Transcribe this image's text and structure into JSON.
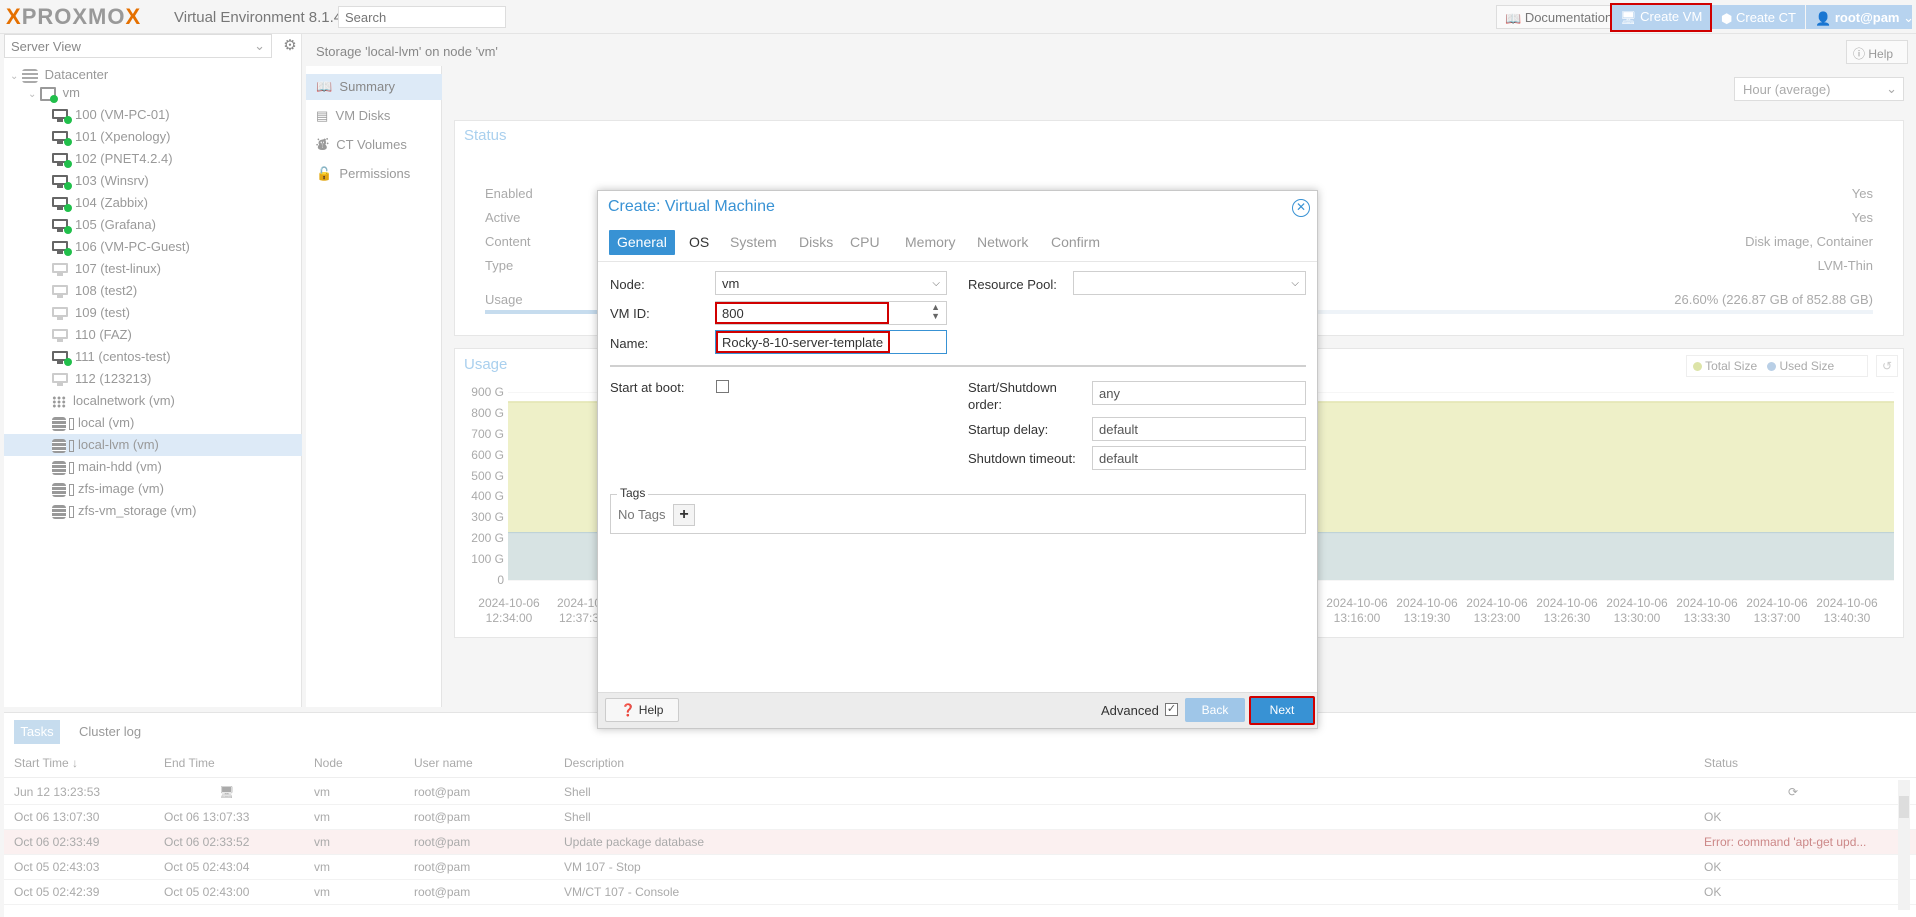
{
  "topbar": {
    "logo_left": "X",
    "logo_mid": "PROXMO",
    "logo_right": "X",
    "version": "Virtual Environment 8.1.4",
    "search_placeholder": "Search",
    "documentation": "Documentation",
    "create_vm": "Create VM",
    "create_ct": "Create CT",
    "user": "root@pam"
  },
  "tree": {
    "view_selector": "Server View",
    "datacenter": "Datacenter",
    "node": "vm",
    "vms": [
      {
        "label": "100 (VM-PC-01)",
        "running": true
      },
      {
        "label": "101 (Xpenology)",
        "running": true
      },
      {
        "label": "102 (PNET4.2.4)",
        "running": true
      },
      {
        "label": "103 (Winsrv)",
        "running": true
      },
      {
        "label": "104 (Zabbix)",
        "running": true
      },
      {
        "label": "105 (Grafana)",
        "running": true
      },
      {
        "label": "106 (VM-PC-Guest)",
        "running": true
      },
      {
        "label": "107 (test-linux)",
        "running": false
      },
      {
        "label": "108 (test2)",
        "running": false
      },
      {
        "label": "109 (test)",
        "running": false
      },
      {
        "label": "110 (FAZ)",
        "running": false
      },
      {
        "label": "111 (centos-test)",
        "running": true
      },
      {
        "label": "112 (123213)",
        "running": false
      }
    ],
    "network": "localnetwork (vm)",
    "storages": [
      "local (vm)",
      "local-lvm (vm)",
      "main-hdd (vm)",
      "zfs-image (vm)",
      "zfs-vm_storage (vm)"
    ]
  },
  "breadcrumb": "Storage 'local-lvm' on node 'vm'",
  "help": "Help",
  "nav": [
    "Summary",
    "VM Disks",
    "CT Volumes",
    "Permissions"
  ],
  "timeframe": "Hour (average)",
  "status": {
    "title": "Status",
    "rows": [
      {
        "label": "Enabled",
        "value": "Yes"
      },
      {
        "label": "Active",
        "value": "Yes"
      },
      {
        "label": "Content",
        "value": "Disk image, Container"
      },
      {
        "label": "Type",
        "value": "LVM-Thin"
      },
      {
        "label": "Usage",
        "value": "26.60% (226.87 GB of 852.88 GB)"
      }
    ],
    "usage_fraction": 0.266
  },
  "usage": {
    "title": "Usage",
    "legend_total": "Total Size",
    "legend_used": "Used Size"
  },
  "chart_data": {
    "type": "area",
    "title": "Usage",
    "yticks": [
      "900 G",
      "800 G",
      "700 G",
      "600 G",
      "500 G",
      "400 G",
      "300 G",
      "200 G",
      "100 G",
      "0"
    ],
    "ylim": [
      0,
      900
    ],
    "xticks": [
      {
        "d": "2024-10-06",
        "t": "12:34:00"
      },
      {
        "d": "2024-10",
        "t": "12:37:3"
      },
      {
        "d": "2024-10-06",
        "t": "13:16:00"
      },
      {
        "d": "2024-10-06",
        "t": "13:19:30"
      },
      {
        "d": "2024-10-06",
        "t": "13:23:00"
      },
      {
        "d": "2024-10-06",
        "t": "13:26:30"
      },
      {
        "d": "2024-10-06",
        "t": "13:30:00"
      },
      {
        "d": "2024-10-06",
        "t": "13:33:30"
      },
      {
        "d": "2024-10-06",
        "t": "13:37:00"
      },
      {
        "d": "2024-10-06",
        "t": "13:40:30"
      }
    ],
    "series": [
      {
        "name": "Total Size",
        "value": 852.88,
        "color": "#eef0c8"
      },
      {
        "name": "Used Size",
        "value": 226.87,
        "color": "#d7e3e3"
      }
    ]
  },
  "dialog": {
    "title": "Create: Virtual Machine",
    "tabs": [
      "General",
      "OS",
      "System",
      "Disks",
      "CPU",
      "Memory",
      "Network",
      "Confirm"
    ],
    "node_label": "Node:",
    "node_value": "vm",
    "resource_pool_label": "Resource Pool:",
    "resource_pool_value": "",
    "vmid_label": "VM ID:",
    "vmid_value": "800",
    "name_label": "Name:",
    "name_value": "Rocky-8-10-server-template",
    "start_at_boot_label": "Start at boot:",
    "start_shutdown_label_1": "Start/Shutdown",
    "start_shutdown_label_2": "order:",
    "start_shutdown_value": "any",
    "startup_delay_label": "Startup delay:",
    "startup_delay_value": "default",
    "shutdown_timeout_label": "Shutdown timeout:",
    "shutdown_timeout_value": "default",
    "tags_label": "Tags",
    "no_tags": "No Tags",
    "help": "Help",
    "advanced": "Advanced",
    "back": "Back",
    "next": "Next"
  },
  "tasks": {
    "tab_tasks": "Tasks",
    "tab_cluster": "Cluster log",
    "headers": [
      "Start Time ↓",
      "End Time",
      "Node",
      "User name",
      "Description",
      "Status"
    ],
    "rows": [
      {
        "start": "Jun 12 13:23:53",
        "end": "",
        "node": "vm",
        "user": "root@pam",
        "desc": "Shell",
        "status": "",
        "err": false
      },
      {
        "start": "Oct 06 13:07:30",
        "end": "Oct 06 13:07:33",
        "node": "vm",
        "user": "root@pam",
        "desc": "Shell",
        "status": "OK",
        "err": false
      },
      {
        "start": "Oct 06 02:33:49",
        "end": "Oct 06 02:33:52",
        "node": "vm",
        "user": "root@pam",
        "desc": "Update package database",
        "status": "Error: command 'apt-get upd...",
        "err": true
      },
      {
        "start": "Oct 05 02:43:03",
        "end": "Oct 05 02:43:04",
        "node": "vm",
        "user": "root@pam",
        "desc": "VM 107 - Stop",
        "status": "OK",
        "err": false
      },
      {
        "start": "Oct 05 02:42:39",
        "end": "Oct 05 02:43:00",
        "node": "vm",
        "user": "root@pam",
        "desc": "VM/CT 107 - Console",
        "status": "OK",
        "err": false
      }
    ]
  }
}
